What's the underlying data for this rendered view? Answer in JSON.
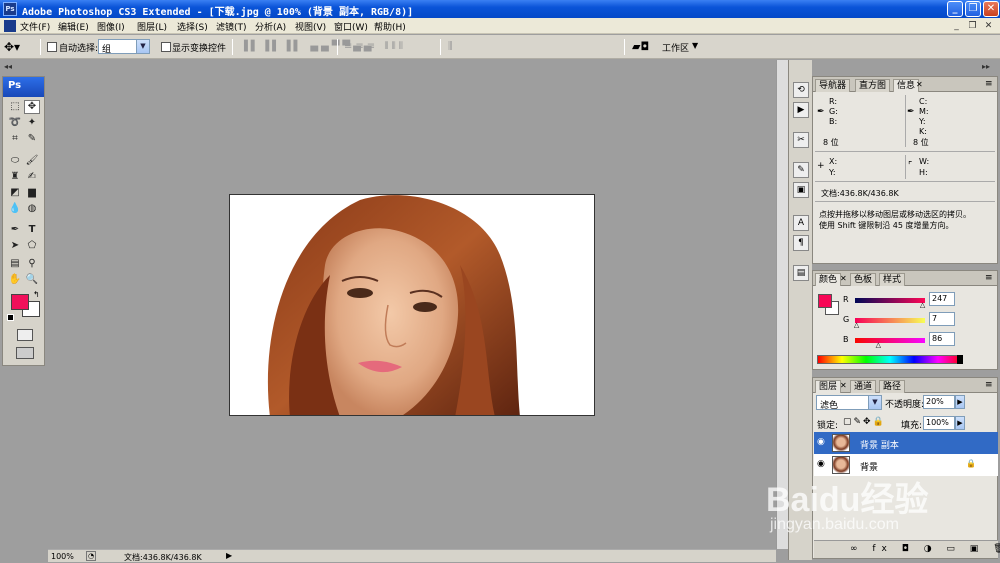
{
  "window": {
    "title": "Adobe Photoshop CS3 Extended - [下载.jpg @ 100% (背景 副本, RGB/8)]",
    "logo": "Ps"
  },
  "menubar": {
    "items": [
      "文件(F)",
      "编辑(E)",
      "图像(I)",
      "图层(L)",
      "选择(S)",
      "滤镜(T)",
      "分析(A)",
      "视图(V)",
      "窗口(W)",
      "帮助(H)"
    ]
  },
  "options": {
    "auto_select_label": "自动选择:",
    "auto_select_value": "组",
    "show_transform_label": "显示变换控件",
    "workspace_label": "工作区"
  },
  "toolbox": {
    "logo": "Ps",
    "foreground_color": "#f0105a",
    "background_color": "#ffffff"
  },
  "status": {
    "zoom": "100%",
    "doc_info": "文档:436.8K/436.8K"
  },
  "info_panel": {
    "tabs": [
      "导航器",
      "直方图",
      "信息"
    ],
    "rgb_labels": [
      "R:",
      "G:",
      "B:"
    ],
    "cmyk_labels": [
      "C:",
      "M:",
      "Y:",
      "K:"
    ],
    "bits_left": "8 位",
    "bits_right": "8 位",
    "xy_labels": [
      "X:",
      "Y:"
    ],
    "wh_labels": [
      "W:",
      "H:"
    ],
    "doc_info": "文档:436.8K/436.8K",
    "hint_line1": "点按并拖移以移动图层或移动选区的拷贝。",
    "hint_line2": "使用 Shift 键限制沿 45 度增量方向。"
  },
  "color_panel": {
    "tabs": [
      "颜色",
      "色板",
      "样式"
    ],
    "labels": [
      "R",
      "G",
      "B"
    ],
    "values": [
      "247",
      "7",
      "86"
    ],
    "fraction": [
      0.969,
      0.027,
      0.337
    ],
    "swatch": "#f70756"
  },
  "layers_panel": {
    "tabs": [
      "图层",
      "通道",
      "路径"
    ],
    "blend_mode": "滤色",
    "opacity_label": "不透明度:",
    "opacity_value": "20%",
    "lock_label": "锁定:",
    "fill_label": "填充:",
    "fill_value": "100%",
    "layers": [
      {
        "name": "背景 副本",
        "selected": true
      },
      {
        "name": "背景",
        "selected": false
      }
    ]
  },
  "watermark": {
    "brand": "Baidu经验",
    "url": "jingyan.baidu.com"
  }
}
